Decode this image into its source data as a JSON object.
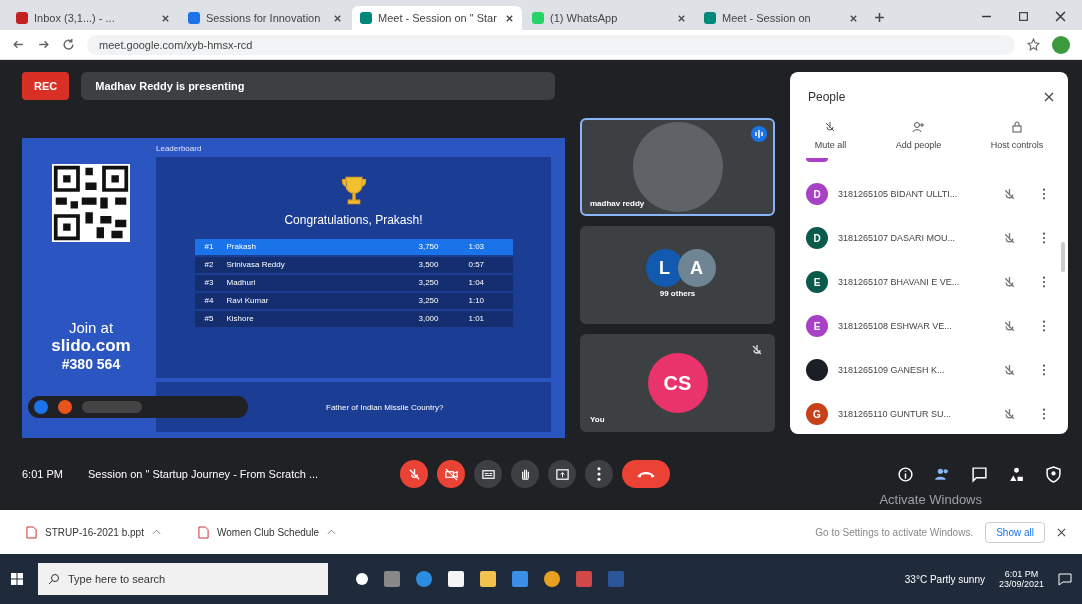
{
  "browser": {
    "tabs": [
      {
        "title": "Inbox (3,1...) - ...",
        "selected": false,
        "color": "#c5221f"
      },
      {
        "title": "Sessions for Innovation",
        "selected": false,
        "color": "#1a73e8"
      },
      {
        "title": "Meet - Session on \" Star",
        "selected": true,
        "color": "#00897b"
      },
      {
        "title": "(1) WhatsApp",
        "selected": false,
        "color": "#25d366"
      },
      {
        "title": "Meet - Session on",
        "selected": false,
        "color": "#00897b"
      }
    ],
    "url": "meet.google.com/xyb-hmsx-rcd"
  },
  "meeting": {
    "recording_label": "REC",
    "presenter_banner": "Madhav Reddy is presenting",
    "slide": {
      "join_text": "Join at",
      "site": "slido.com",
      "code": "#380 564",
      "header": "Leaderboard",
      "congrats": "Congratulations, Prakash!",
      "leaderboard": [
        {
          "rank": "#1",
          "name": "Prakash",
          "points": "3,750",
          "time": "1:03",
          "selected": true
        },
        {
          "rank": "#2",
          "name": "Srinivasa Reddy",
          "points": "3,500",
          "time": "0:57",
          "selected": false
        },
        {
          "rank": "#3",
          "name": "Madhuri",
          "points": "3,250",
          "time": "1:04",
          "selected": false
        },
        {
          "rank": "#4",
          "name": "Ravi Kumar",
          "points": "3,250",
          "time": "1:10",
          "selected": false
        },
        {
          "rank": "#5",
          "name": "Kishore",
          "points": "3,000",
          "time": "1:01",
          "selected": false
        }
      ],
      "question": "Father of Indian Missile Country?"
    },
    "tiles": [
      {
        "kind": "video",
        "name": "madhav reddy",
        "speaking": true
      },
      {
        "kind": "group",
        "name": "99 others",
        "speaking": false,
        "avatars": [
          {
            "initial": "L",
            "color": "#1259b0"
          },
          {
            "initial": "A",
            "color": "#6f8593"
          }
        ]
      },
      {
        "kind": "self",
        "name": "You",
        "speaking": false,
        "avatars": [
          {
            "initial": "CS",
            "color": "#e8336b"
          }
        ]
      }
    ]
  },
  "people_panel": {
    "title": "People",
    "actions": [
      "Mute all",
      "Add people",
      "Host controls"
    ],
    "participants": [
      {
        "initial": "D",
        "name": "3181265105 BIDANT ULLTI...",
        "color": "#a742c6"
      },
      {
        "initial": "D",
        "name": "3181265107 DASARI MOU...",
        "color": "#0b5b4c"
      },
      {
        "initial": "E",
        "name": "3181265107 BHAVANI E VE...",
        "color": "#0b5b4c"
      },
      {
        "initial": "E",
        "name": "3181265108 ESHWAR VE...",
        "color": "#a742c6"
      },
      {
        "name": "3181265109 GANESH K...",
        "color": "#1a1f26"
      },
      {
        "initial": "G",
        "name": "3181265110 GUNTUR SU...",
        "color": "#c8411a"
      }
    ]
  },
  "bottom_bar": {
    "time": "6:01 PM",
    "meeting_title": "Session on \" Startup Journey - From Scratch ...",
    "controls": [
      {
        "kind": "mic",
        "off": true
      },
      {
        "kind": "camera",
        "off": true
      },
      {
        "kind": "captions",
        "off": false
      },
      {
        "kind": "hand",
        "off": false
      },
      {
        "kind": "present",
        "off": false
      },
      {
        "kind": "more",
        "off": false
      },
      {
        "kind": "end"
      }
    ],
    "right": [
      {
        "kind": "info"
      },
      {
        "kind": "people"
      },
      {
        "kind": "chat"
      },
      {
        "kind": "activities"
      },
      {
        "kind": "host"
      }
    ]
  },
  "downloads": [
    {
      "name": "STRUP-16-2021 b.ppt"
    },
    {
      "name": "Women Club Schedule"
    }
  ],
  "show_all": "Show all",
  "activation": {
    "title": "Activate Windows",
    "hint": "Go to Settings to activate Windows."
  },
  "taskbar": {
    "search_placeholder": "Type here to search",
    "weather": "33°C Partly sunny",
    "clock_time": "6:01 PM",
    "clock_date": "23/09/2021"
  }
}
